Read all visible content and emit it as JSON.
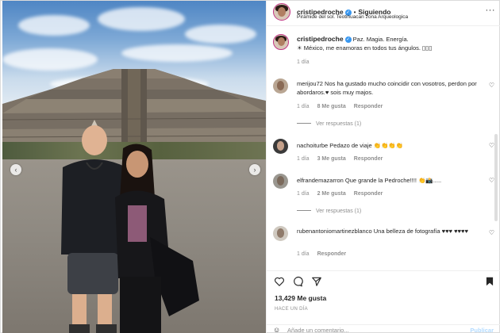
{
  "post": {
    "nav_prev": "‹",
    "nav_next": "›"
  },
  "header": {
    "username": "cristipedroche",
    "follow_label": "Siguiendo",
    "location": "Pirámide del sol. Teotihuacan zona Arqueologica",
    "verified": "✓",
    "more": "···"
  },
  "caption": {
    "username": "cristipedroche",
    "text_line1": "Paz. Magia. Energía.",
    "text_line2": "☀ México, me enamoras en todos tus ángulos. ▯▯▯",
    "time": "1 día"
  },
  "comments": [
    {
      "username": "merijou72",
      "text": "Nos ha gustado mucho coincidir con vosotros, perdon por abordaros.♥ sois muy majos.",
      "time": "1 día",
      "likes": "8 Me gusta",
      "reply": "Responder",
      "replies": "Ver respuestas (1)"
    },
    {
      "username": "nachoiturbe",
      "text": "Pedazo de viaje 👏👏👏👏",
      "time": "1 día",
      "likes": "3 Me gusta",
      "reply": "Responder"
    },
    {
      "username": "elfrandemazarron",
      "text": "Que grande la Pedroche!!!! 👏📸.....",
      "time": "1 día",
      "likes": "2 Me gusta",
      "reply": "Responder",
      "replies": "Ver respuestas (1)"
    },
    {
      "username": "rubenantoniomartinezblanco",
      "text": "Una belleza de fotografía ♥♥♥ ♥♥♥♥",
      "time": "1 día",
      "reply": "Responder"
    }
  ],
  "actions": {
    "likes": "13,429 Me gusta",
    "ago": "HACE UN DÍA"
  },
  "add_comment": {
    "emoji": "☺",
    "placeholder": "Añade un comentario...",
    "publish": "Publicar"
  },
  "colors": {
    "verified": "#3897f0",
    "publish": "#b3dbff"
  }
}
